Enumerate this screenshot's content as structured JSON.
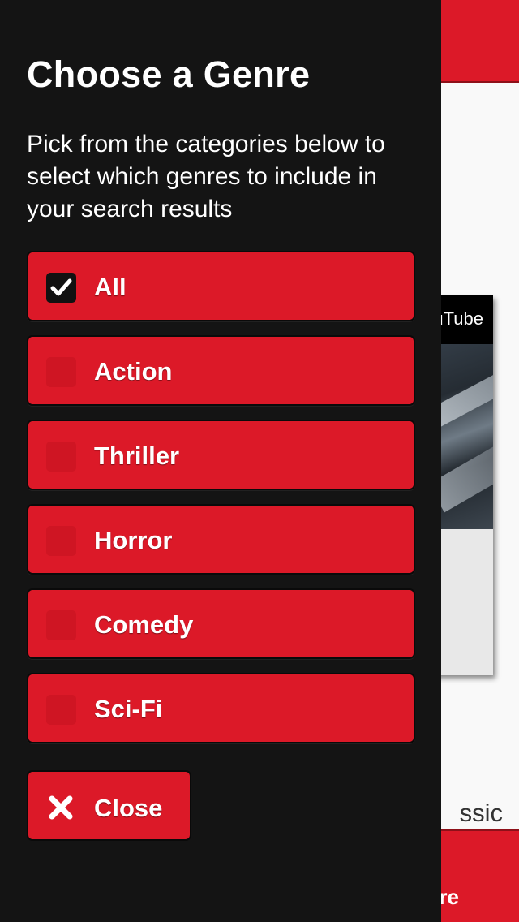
{
  "background": {
    "video_label": "uTube",
    "partial_text": "ssic",
    "footer_text": "re"
  },
  "panel": {
    "title": "Choose a Genre",
    "description": "Pick from the categories below to select which genres to include in your search results",
    "genres": [
      {
        "label": "All",
        "checked": true
      },
      {
        "label": "Action",
        "checked": false
      },
      {
        "label": "Thriller",
        "checked": false
      },
      {
        "label": "Horror",
        "checked": false
      },
      {
        "label": "Comedy",
        "checked": false
      },
      {
        "label": "Sci-Fi",
        "checked": false
      }
    ],
    "close_label": "Close",
    "close_icon": "close-icon"
  },
  "colors": {
    "accent": "#dc1928",
    "panel_bg": "#141414",
    "checkbox_checked_bg": "#111111"
  }
}
